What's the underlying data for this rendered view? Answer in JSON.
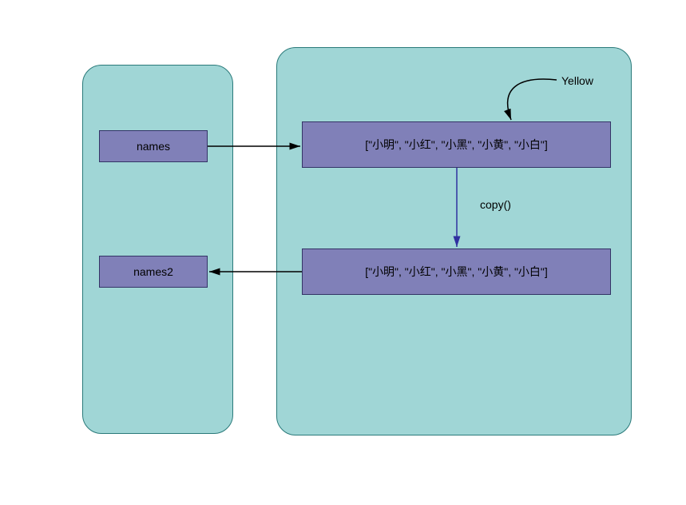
{
  "boxes": {
    "names": "names",
    "names2": "names2",
    "list1": "[\"小明\", \"小红\", \"小黑\", \"小黄\", \"小白\"]",
    "list2": "[\"小明\", \"小红\", \"小黑\", \"小黄\", \"小白\"]"
  },
  "labels": {
    "yellow": "Yellow",
    "copy": "copy()"
  },
  "colors": {
    "panel_bg": "#a0d6d6",
    "panel_border": "#2a7a7a",
    "box_bg": "#8080b8",
    "box_border": "#333366"
  }
}
